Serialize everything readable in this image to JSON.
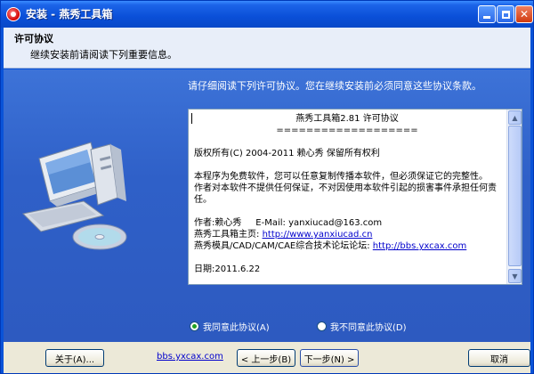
{
  "window": {
    "title": "安装 - 燕秀工具箱"
  },
  "header": {
    "title": "许可协议",
    "subtitle": "继续安装前请阅读下列重要信息。"
  },
  "body": {
    "prompt": "请仔细阅读下列许可协议。您在继续安装前必须同意这些协议条款。",
    "license": {
      "heading": "燕秀工具箱2.81 许可协议",
      "separator": "===================",
      "copyright": "版权所有(C) 2004-2011 赖心秀 保留所有权利",
      "para1": "本程序为免费软件，您可以任意复制传播本软件，但必须保证它的完整性。",
      "para2": "作者对本软件不提供任何保证，不对因使用本软件引起的损害事件承担任何责任。",
      "author_label": "作者:赖心秀",
      "email_label": "E-Mail:",
      "email": "yanxiucad@163.com",
      "homepage_label": "燕秀工具箱主页:",
      "homepage_url": "http://www.yanxiucad.cn",
      "forum_label": "燕秀模具/CAD/CAM/CAE综合技术论坛论坛:",
      "forum_url": "http://bbs.yxcax.com",
      "date": "日期:2011.6.22"
    },
    "radio_agree": "我同意此协议(A)",
    "radio_disagree": "我不同意此协议(D)",
    "agree_selected": true
  },
  "footer": {
    "about_button": "关于(A)...",
    "link": "bbs.yxcax.com",
    "back_button": "< 上一步(B)",
    "next_button": "下一步(N) >",
    "cancel_button": "取消"
  },
  "icons": {
    "app": "app-icon",
    "computer": "computer-illustration"
  }
}
